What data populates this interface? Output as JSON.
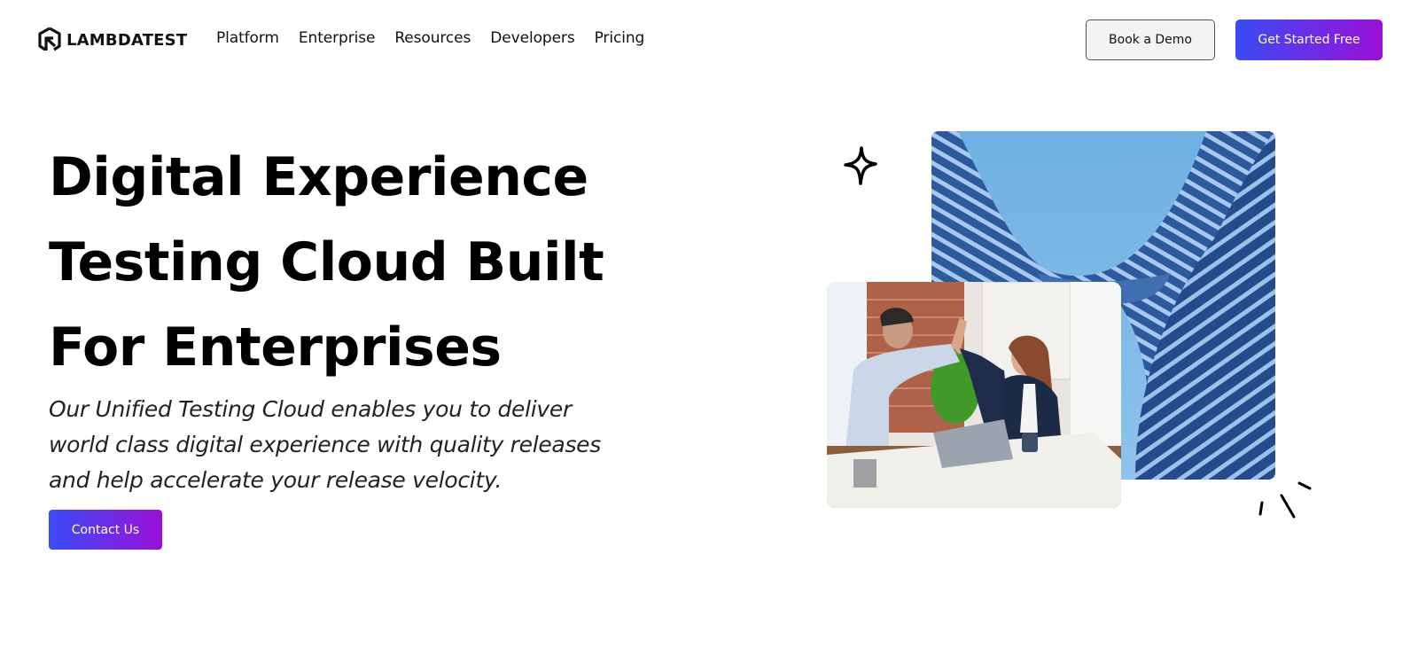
{
  "header": {
    "logo_text": "LAMBDATEST",
    "logo_icon": "lambdatest-logo-icon",
    "nav": [
      {
        "label": "Platform"
      },
      {
        "label": "Enterprise"
      },
      {
        "label": "Resources"
      },
      {
        "label": "Developers"
      },
      {
        "label": "Pricing"
      }
    ],
    "book_demo_label": "Book a Demo",
    "get_started_label": "Get Started Free"
  },
  "hero": {
    "title_lines": [
      "Digital Experience",
      "Testing Cloud Built",
      "For Enterprises"
    ],
    "subtitle_lines": [
      "Our Unified Testing Cloud enables you to deliver",
      "world class digital experience with quality releases",
      "and help accelerate your release velocity."
    ],
    "contact_label": "Contact Us"
  },
  "visuals": {
    "sparkle_icon": "sparkle-icon",
    "building_image": "building-facade-image",
    "office_image": "office-high-five-image",
    "decoration": "accent-lines-icon"
  },
  "colors": {
    "gradient_start": "#3a4bf5",
    "gradient_end": "#9a10d8",
    "text": "#000000",
    "demo_button_bg": "#f3f3f3"
  }
}
